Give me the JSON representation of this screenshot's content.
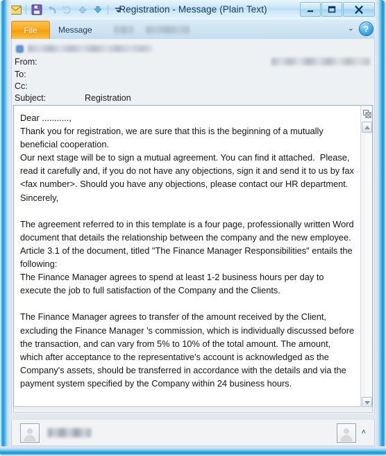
{
  "window": {
    "title": "Registration  -  Message (Plain Text)",
    "minimize_label": "–",
    "maximize_label": "□",
    "close_label": "✕"
  },
  "quick_access": {
    "items": [
      {
        "name": "envelope-icon",
        "tooltip": "Message"
      },
      {
        "name": "save-icon",
        "tooltip": "Save"
      },
      {
        "name": "undo-icon",
        "tooltip": "Undo"
      },
      {
        "name": "redo-icon",
        "tooltip": "Redo"
      },
      {
        "name": "previous-item-icon",
        "tooltip": "Previous Item"
      },
      {
        "name": "next-item-icon",
        "tooltip": "Next Item"
      },
      {
        "name": "customize-dropdown-icon",
        "tooltip": "Customize Quick Access Toolbar"
      }
    ]
  },
  "ribbon": {
    "file_tab": "File",
    "message_tab": "Message",
    "collapse_glyph": "⌄",
    "help_glyph": "?"
  },
  "header": {
    "info_bar_text": "",
    "from_label": "From:",
    "from_value": "",
    "to_label": "To:",
    "to_value": "",
    "cc_label": "Cc:",
    "cc_value": "",
    "sent_value": "",
    "subject_label": "Subject:",
    "subject_value": "Registration"
  },
  "body": {
    "text": "Dear ...........,\nThank you for registration, we are sure that this is the beginning of a mutually beneficial cooperation.\nOur next stage will be to sign a mutual agreement. You can find it attached.  Please, read it carefully and, if you do not have any objections, sign it and send it to us by fax <fax number>. Should you have any objections, please contact our HR department.\nSincerely,\n\nThe agreement referred to in this template is a four page, professionally written Word document that details the relationship between the company and the new employee. Article 3.1 of the document, titled \"The Finance Manager Responsibilities\" entails the following:\nThe Finance Manager agrees to spend at least 1-2 business hours per day to execute the job to full satisfaction of the Company and the Clients.\n\nThe Finance Manager agrees to transfer of the amount received by the Client, excluding the Finance Manager 's commission, which is individually discussed before the transaction, and can vary from 5% to 10% of the total amount. The amount, which after acceptance to the representative's account is acknowledged as the Company's assets, should be transferred in accordance with the details and via the payment system specified by the Company within 24 business hours."
  },
  "people_pane": {
    "contact_name": "",
    "expand_glyph": "˄"
  },
  "colors": {
    "frame_blue": "#1a9bdc",
    "file_tab_orange": "#f59d08",
    "title_text": "#15385c",
    "body_background": "#ffffff",
    "pane_background": "#eef1f4"
  }
}
